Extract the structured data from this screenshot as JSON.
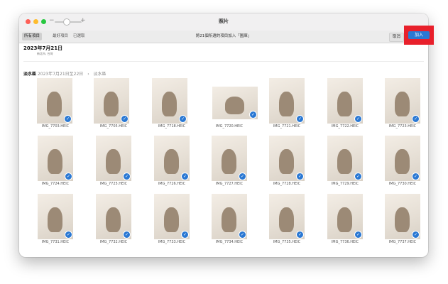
{
  "window": {
    "title": "照片"
  },
  "toolbar": {
    "tabs": [
      {
        "label": "所有項目",
        "active": true
      },
      {
        "label": "最好項目",
        "active": false
      },
      {
        "label": "已選取",
        "active": false
      }
    ],
    "hint": "將21個所選的項目加入「圖庫」",
    "cancel_label": "取消",
    "add_label": "加入",
    "add_highlight_color": "#e8202b",
    "accent_color": "#2a78d3"
  },
  "date_group": {
    "date": "2023年7月21日",
    "sub": "新北市, 台灣"
  },
  "section": {
    "title": "淡水區",
    "range": "2023年7月21日至22日",
    "place": "淡水區"
  },
  "photos": [
    {
      "name": "IMG_7703.HEIC",
      "selected": true
    },
    {
      "name": "IMG_7705.HEIC",
      "selected": true
    },
    {
      "name": "IMG_7718.HEIC",
      "selected": true
    },
    {
      "name": "IMG_7720.HEIC",
      "selected": true
    },
    {
      "name": "IMG_7721.HEIC",
      "selected": true
    },
    {
      "name": "IMG_7722.HEIC",
      "selected": true
    },
    {
      "name": "IMG_7723.HEIC",
      "selected": true
    },
    {
      "name": "IMG_7724.HEIC",
      "selected": true
    },
    {
      "name": "IMG_7725.HEIC",
      "selected": true
    },
    {
      "name": "IMG_7726.HEIC",
      "selected": true
    },
    {
      "name": "IMG_7727.HEIC",
      "selected": true
    },
    {
      "name": "IMG_7728.HEIC",
      "selected": true
    },
    {
      "name": "IMG_7729.HEIC",
      "selected": true
    },
    {
      "name": "IMG_7730.HEIC",
      "selected": true
    },
    {
      "name": "IMG_7731.HEIC",
      "selected": true
    },
    {
      "name": "IMG_7732.HEIC",
      "selected": true
    },
    {
      "name": "IMG_7733.HEIC",
      "selected": true
    },
    {
      "name": "IMG_7734.HEIC",
      "selected": true
    },
    {
      "name": "IMG_7735.HEIC",
      "selected": true
    },
    {
      "name": "IMG_7736.HEIC",
      "selected": true
    },
    {
      "name": "IMG_7737.HEIC",
      "selected": true
    }
  ],
  "icons": {
    "close": "close-icon",
    "minimize": "minimize-icon",
    "zoom": "zoom-icon",
    "check": "checkmark-icon"
  }
}
